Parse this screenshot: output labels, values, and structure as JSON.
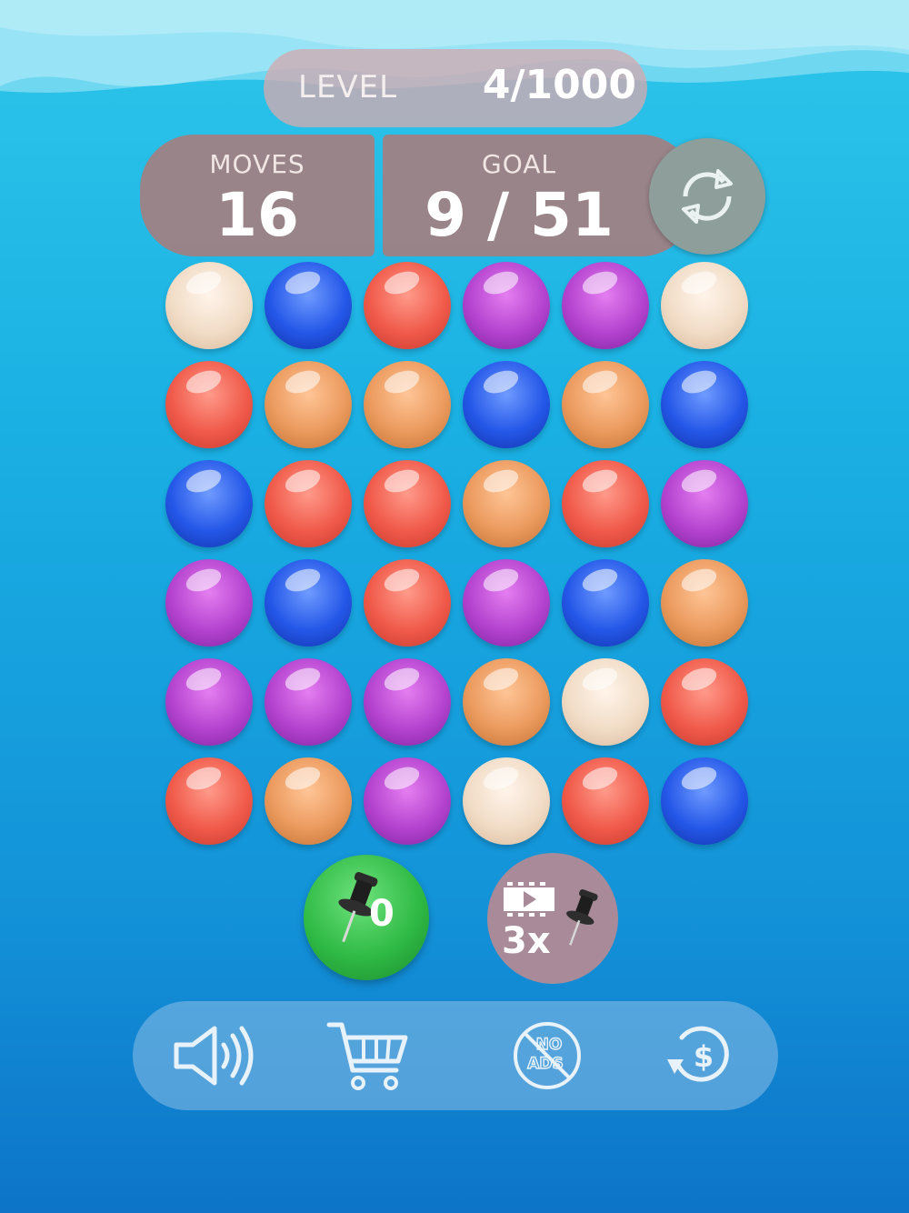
{
  "level": {
    "label": "LEVEL",
    "value": "4/1000"
  },
  "moves": {
    "label": "MOVES",
    "value": "16"
  },
  "goal": {
    "label": "GOAL",
    "value": "9 / 51"
  },
  "colors": {
    "cream": "#f1dcc6",
    "blue": "#2457e8",
    "red": "#f05a4a",
    "purple": "#b443cf",
    "orange": "#eb9a5e"
  },
  "board": [
    [
      "cream",
      "blue",
      "red",
      "purple",
      "purple",
      "cream"
    ],
    [
      "red",
      "orange",
      "orange",
      "blue",
      "orange",
      "blue"
    ],
    [
      "blue",
      "red",
      "red",
      "orange",
      "red",
      "purple"
    ],
    [
      "purple",
      "blue",
      "red",
      "purple",
      "blue",
      "orange"
    ],
    [
      "purple",
      "purple",
      "purple",
      "orange",
      "cream",
      "red"
    ],
    [
      "red",
      "orange",
      "purple",
      "cream",
      "red",
      "blue"
    ]
  ],
  "boosters": {
    "pin": {
      "icon": "pushpin-icon",
      "count": "0"
    },
    "video_pin": {
      "icon": "video-icon",
      "multiplier": "3x"
    }
  },
  "toolbar": {
    "sound_icon": "speaker-icon",
    "shop_icon": "cart-icon",
    "no_ads_icon": "no-ads-icon",
    "no_ads_text": "NO ADS",
    "restore_icon": "restore-purchase-icon",
    "restore_symbol": "$"
  }
}
